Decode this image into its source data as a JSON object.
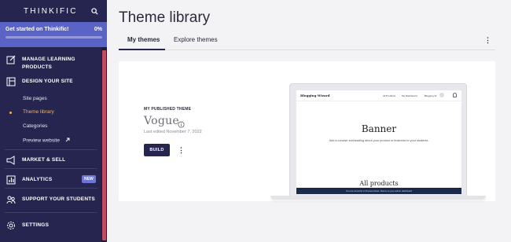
{
  "brand": {
    "logo": "THINKIFIC"
  },
  "getstarted": {
    "label": "Get started on Thinkific!",
    "percent_label": "0%",
    "progress": 0
  },
  "sidebar": {
    "sections": [
      {
        "label": "MANAGE LEARNING PRODUCTS",
        "icon": "pencil-icon"
      },
      {
        "label": "DESIGN YOUR SITE",
        "icon": "layout-icon"
      },
      {
        "label": "MARKET & SELL",
        "icon": "megaphone-icon"
      },
      {
        "label": "ANALYTICS",
        "icon": "analytics-icon",
        "badge": "NEW"
      },
      {
        "label": "SUPPORT YOUR STUDENTS",
        "icon": "people-icon"
      },
      {
        "label": "SETTINGS",
        "icon": "gear-icon"
      }
    ],
    "subitems": [
      {
        "label": "Site pages"
      },
      {
        "label": "Theme library",
        "active": true
      },
      {
        "label": "Categories"
      },
      {
        "label": "Preview website",
        "icon": "external-link-icon"
      }
    ]
  },
  "page": {
    "title": "Theme library"
  },
  "tabs": [
    {
      "label": "My themes",
      "active": true
    },
    {
      "label": "Explore themes"
    }
  ],
  "theme_card": {
    "eyebrow": "MY PUBLISHED THEME",
    "name": "Vogue",
    "last_edited": "Last edited November 7, 2022",
    "build_label": "BUILD"
  },
  "preview": {
    "site_name": "Blogging Wizard",
    "nav": [
      "All Products",
      "My Dashboard",
      "Blogging W"
    ],
    "banner": "Banner",
    "subtitle": "Add a concise subheading about your product or business to your students.",
    "section_title": "All products",
    "notice": "You are currently in Preview Mode. Return to your admin dashboard"
  },
  "colors": {
    "sidebar_bg": "#252550",
    "accent": "#5a63c6",
    "active": "#f2b25a"
  }
}
